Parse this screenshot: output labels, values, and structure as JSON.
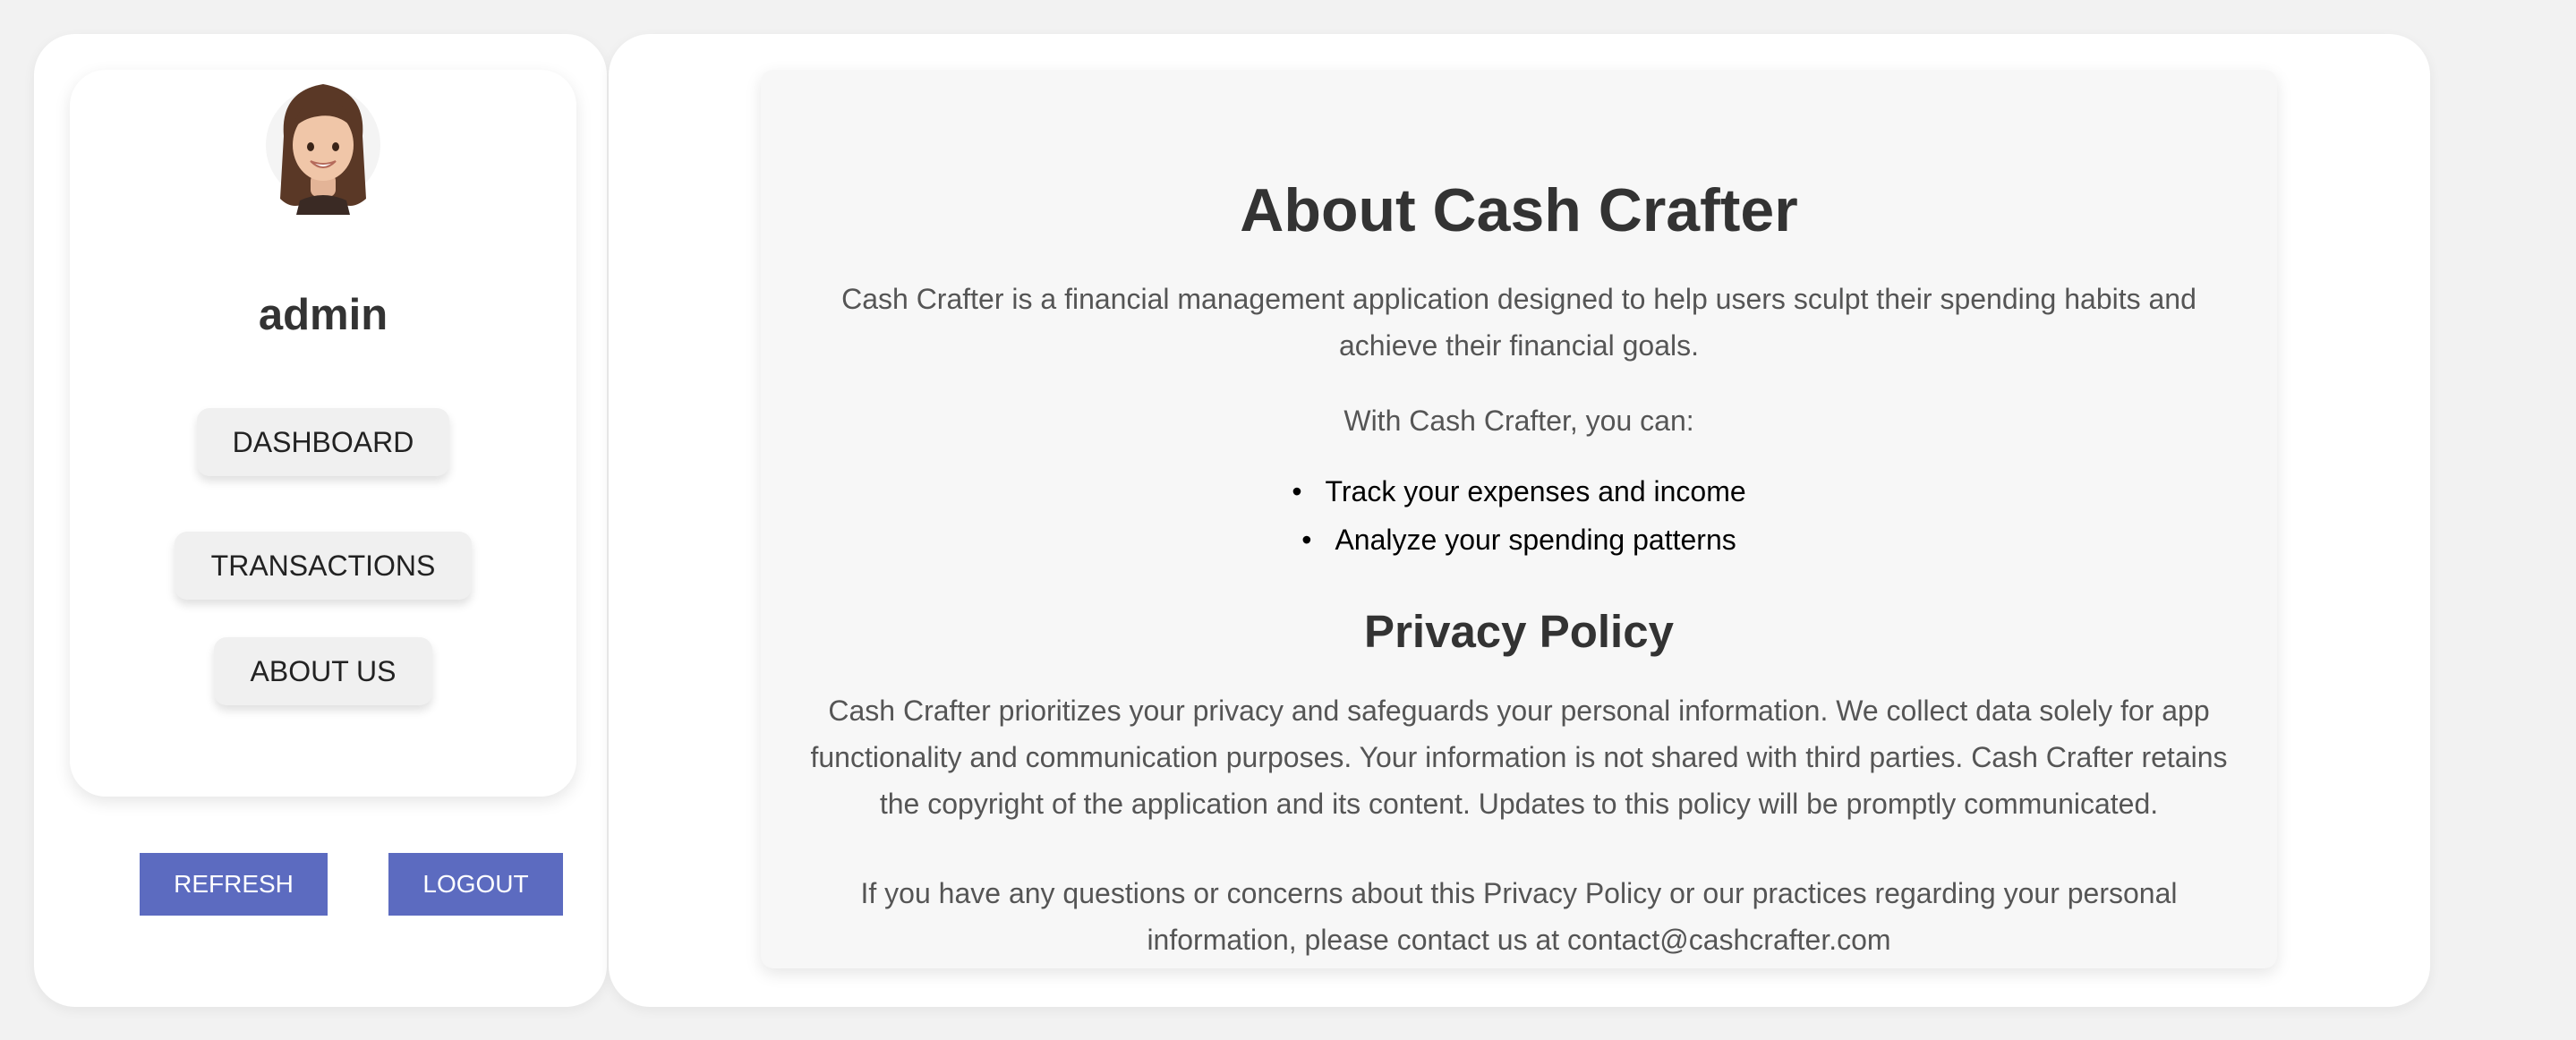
{
  "sidebar": {
    "username": "admin",
    "nav": {
      "dashboard": "DASHBOARD",
      "transactions": "TRANSACTIONS",
      "about": "ABOUT US"
    },
    "actions": {
      "refresh": "REFRESH",
      "logout": "LOGOUT"
    }
  },
  "about": {
    "title": "About Cash Crafter",
    "description": "Cash Crafter is a financial management application designed to help users sculpt their spending habits and achieve their financial goals.",
    "intro": "With Cash Crafter, you can:",
    "features": [
      "Track your expenses and income",
      "Analyze your spending patterns"
    ],
    "privacy_title": "Privacy Policy",
    "privacy_text": "Cash Crafter prioritizes your privacy and safeguards your personal information. We collect data solely for app functionality and communication purposes. Your information is not shared with third parties. Cash Crafter retains the copyright of the application and its content. Updates to this policy will be promptly communicated.",
    "contact_text": "If you have any questions or concerns about this Privacy Policy or our practices regarding your personal information, please contact us at contact@cashcrafter.com"
  },
  "colors": {
    "accent": "#5c6bc0",
    "background": "#f2f2f2",
    "card": "#f7f7f7"
  },
  "icons": {
    "avatar": "memoji-avatar"
  }
}
